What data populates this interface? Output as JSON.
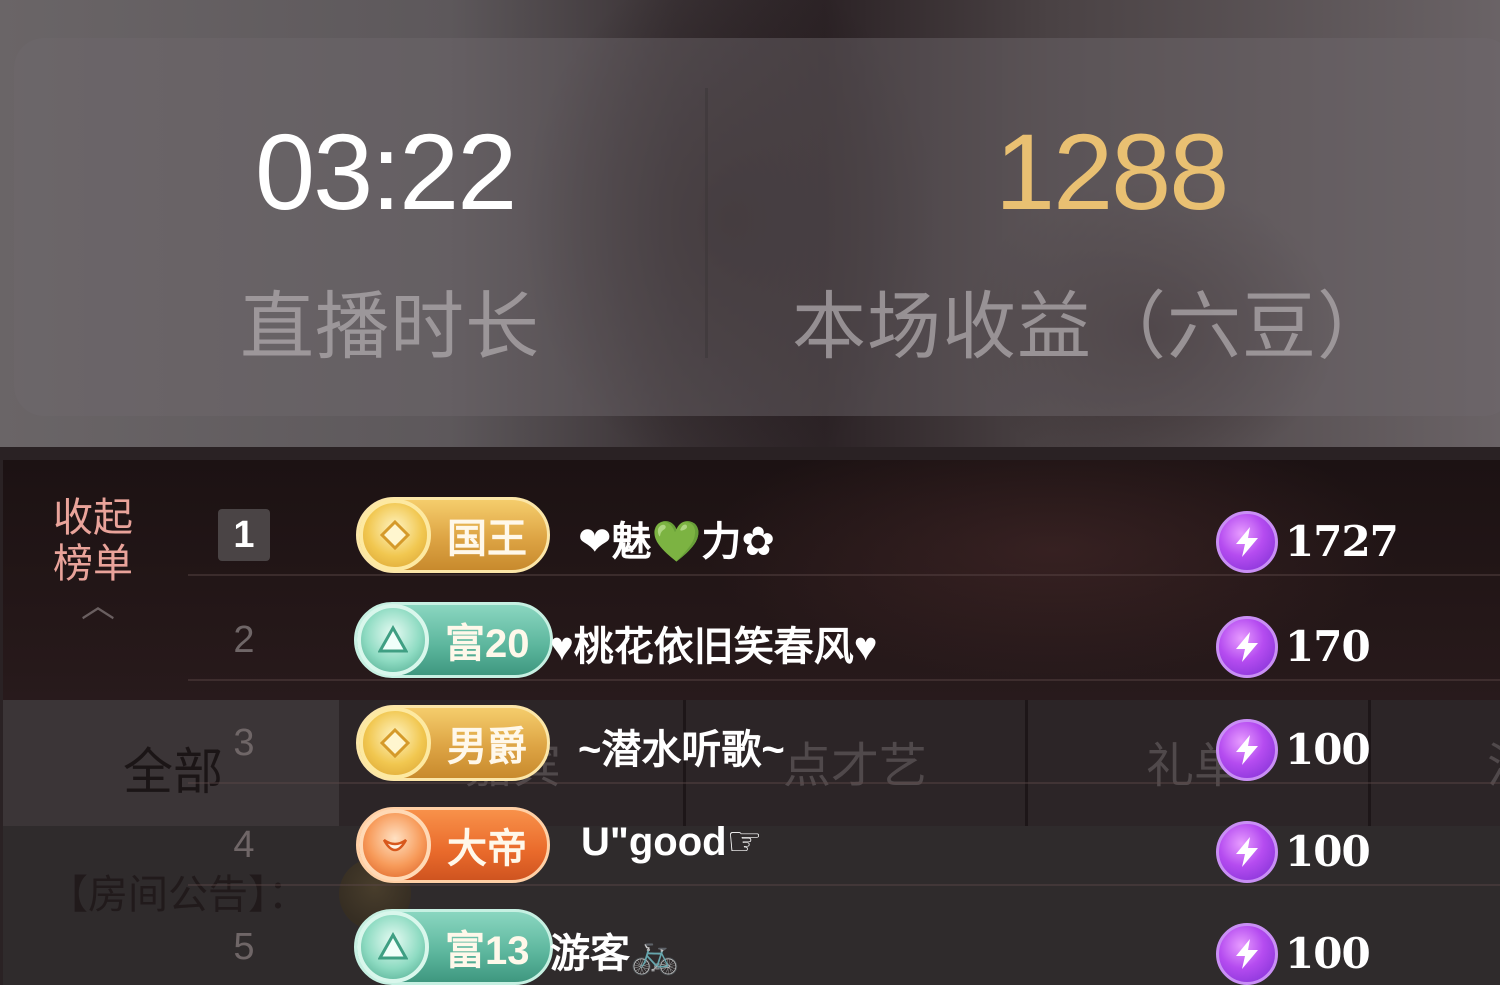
{
  "stats": {
    "duration_value": "03:22",
    "duration_label": "直播时长",
    "income_value": "1288",
    "income_label": "本场收益（六豆）",
    "income_color": "#e9c072"
  },
  "sidebar": {
    "collapse_line1": "收起",
    "collapse_line2": "榜单",
    "collapse_icon": "chevron-up-icon"
  },
  "tabs": {
    "all": "全部",
    "t2": "嘉宾",
    "t3": "点才艺",
    "t4": "礼单",
    "t5": "活"
  },
  "notice": {
    "label": "【房间公告】："
  },
  "ranking": [
    {
      "rank": "1",
      "badge_style": "gold",
      "badge_icon": "crown-gem-icon",
      "badge_text": "国王",
      "nickname": "❤魅💚力✿",
      "score_icon": "lightning-icon",
      "score": "1727"
    },
    {
      "rank": "2",
      "badge_style": "teal",
      "badge_icon": "wealth-gem-icon",
      "badge_text": "富20",
      "nickname": "♥桃花依旧笑春风♥",
      "score_icon": "lightning-icon",
      "score": "170"
    },
    {
      "rank": "3",
      "badge_style": "gold",
      "badge_icon": "noble-gem-icon",
      "badge_text": "男爵",
      "nickname": "~潜水听歌~",
      "score_icon": "lightning-icon",
      "score": "100"
    },
    {
      "rank": "4",
      "badge_style": "orange",
      "badge_icon": "emperor-gem-icon",
      "badge_text": "大帝",
      "nickname": "U\"good☞",
      "score_icon": "lightning-icon",
      "score": "100"
    },
    {
      "rank": "5",
      "badge_style": "teal",
      "badge_icon": "wealth-gem-icon",
      "badge_text": "富13",
      "nickname": "游客🚲",
      "score_icon": "lightning-icon",
      "score": "100"
    }
  ]
}
